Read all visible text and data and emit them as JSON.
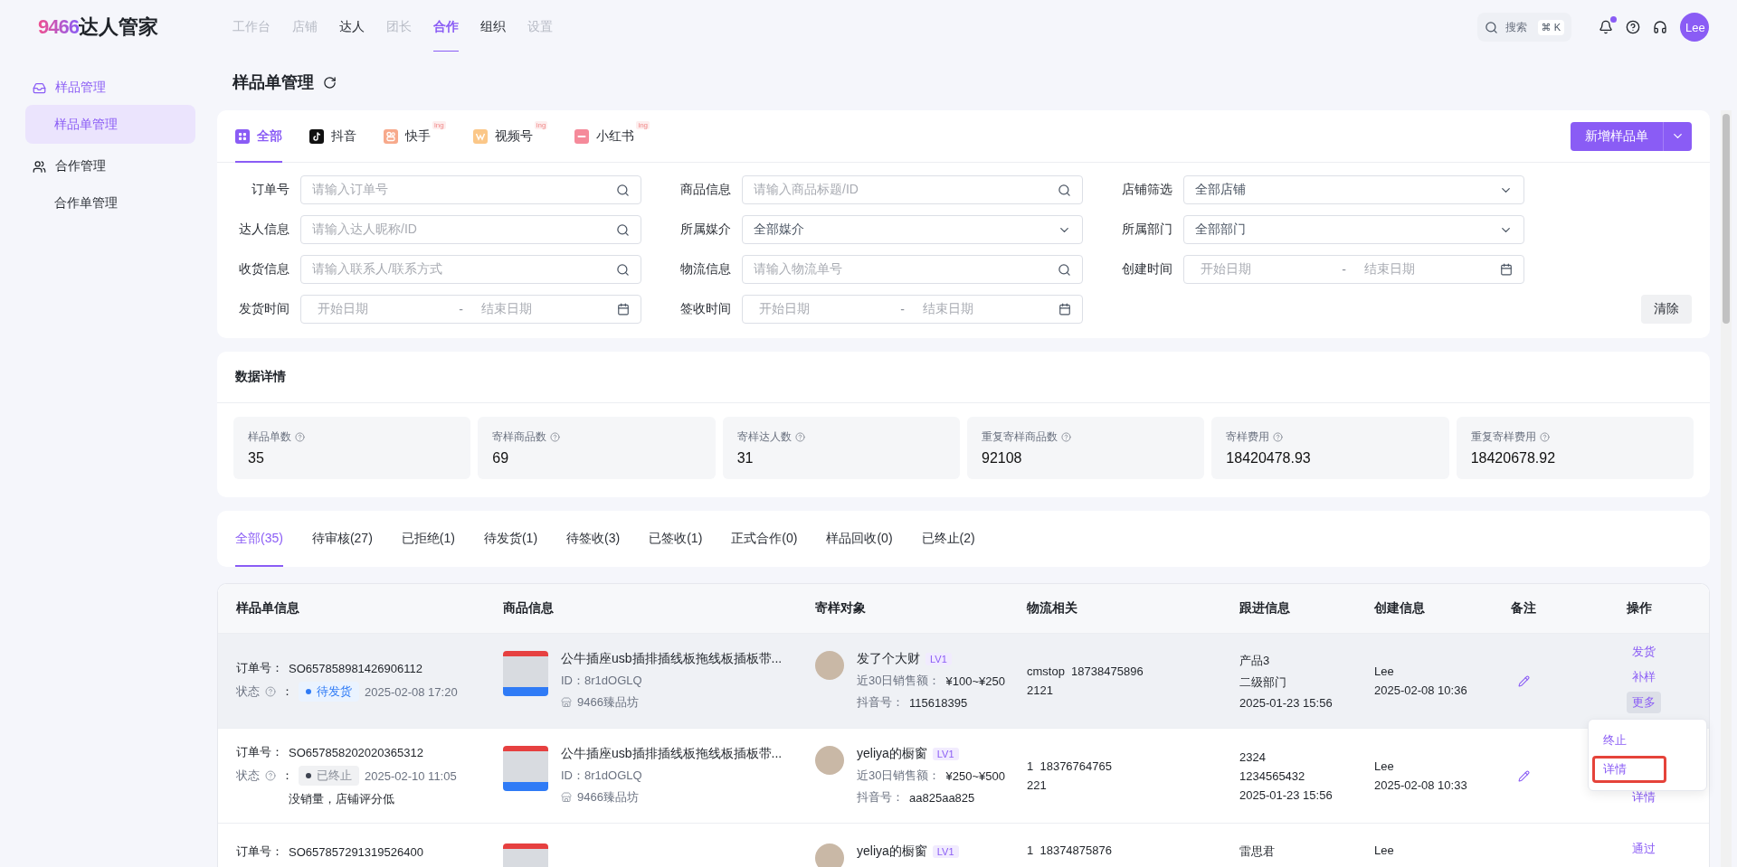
{
  "header": {
    "logo": {
      "number": "9466",
      "text": "达人管家"
    },
    "nav": [
      {
        "label": "工作台",
        "selected": false,
        "disabled": true
      },
      {
        "label": "店铺",
        "selected": false,
        "disabled": true
      },
      {
        "label": "达人",
        "selected": false,
        "disabled": false
      },
      {
        "label": "团长",
        "selected": false,
        "disabled": true
      },
      {
        "label": "合作",
        "selected": true,
        "disabled": false
      },
      {
        "label": "组织",
        "selected": false,
        "disabled": false
      },
      {
        "label": "设置",
        "selected": false,
        "disabled": true
      }
    ],
    "search": {
      "placeholder": "搜索",
      "shortcut": "⌘ K"
    },
    "notification_dot": true,
    "avatar": "Lee"
  },
  "sidebar": [
    {
      "label": "样品管理",
      "kind": "box",
      "active": true,
      "children": [
        {
          "label": "样品单管理",
          "selected": true
        }
      ]
    },
    {
      "label": "合作管理",
      "kind": "people",
      "active": false,
      "children": [
        {
          "label": "合作单管理",
          "selected": false
        }
      ]
    }
  ],
  "page_title": "样品单管理",
  "platform_tabs": [
    {
      "label": "全部",
      "kind": "all",
      "selected": true
    },
    {
      "label": "抖音",
      "kind": "douyin",
      "selected": false
    },
    {
      "label": "快手",
      "kind": "kuaishou",
      "selected": false,
      "badge": "ing"
    },
    {
      "label": "视频号",
      "kind": "shipinhao",
      "selected": false,
      "badge": "ing"
    },
    {
      "label": "小红书",
      "kind": "xiaohongshu",
      "selected": false,
      "badge": "ing"
    }
  ],
  "create_button": "新增样品单",
  "filters": [
    {
      "label": "订单号",
      "kind": "search",
      "placeholder": "请输入订单号"
    },
    {
      "label": "商品信息",
      "kind": "search",
      "placeholder": "请输入商品标题/ID"
    },
    {
      "label": "店铺筛选",
      "kind": "select",
      "value": "全部店铺"
    },
    {
      "label": "达人信息",
      "kind": "search",
      "placeholder": "请输入达人昵称/ID"
    },
    {
      "label": "所属媒介",
      "kind": "select",
      "value": "全部媒介"
    },
    {
      "label": "所属部门",
      "kind": "select",
      "value": "全部部门"
    },
    {
      "label": "收货信息",
      "kind": "search",
      "placeholder": "请输入联系人/联系方式"
    },
    {
      "label": "物流信息",
      "kind": "search",
      "placeholder": "请输入物流单号"
    },
    {
      "label": "创建时间",
      "kind": "daterange",
      "start_placeholder": "开始日期",
      "separator": "-",
      "end_placeholder": "结束日期"
    },
    {
      "label": "发货时间",
      "kind": "daterange",
      "start_placeholder": "开始日期",
      "separator": "-",
      "end_placeholder": "结束日期"
    },
    {
      "label": "签收时间",
      "kind": "daterange",
      "start_placeholder": "开始日期",
      "separator": "-",
      "end_placeholder": "结束日期"
    }
  ],
  "clear_button": "清除",
  "stats": {
    "title": "数据详情",
    "items": [
      {
        "label": "样品单数",
        "value": "35"
      },
      {
        "label": "寄样商品数",
        "value": "69"
      },
      {
        "label": "寄样达人数",
        "value": "31"
      },
      {
        "label": "重复寄样商品数",
        "value": "92108"
      },
      {
        "label": "寄样费用",
        "value": "18420478.93"
      },
      {
        "label": "重复寄样费用",
        "value": "18420678.92"
      }
    ]
  },
  "status_tabs": [
    {
      "label": "全部(35)",
      "selected": true
    },
    {
      "label": "待审核(27)",
      "selected": false
    },
    {
      "label": "已拒绝(1)",
      "selected": false
    },
    {
      "label": "待发货(1)",
      "selected": false
    },
    {
      "label": "待签收(3)",
      "selected": false
    },
    {
      "label": "已签收(1)",
      "selected": false
    },
    {
      "label": "正式合作(0)",
      "selected": false
    },
    {
      "label": "样品回收(0)",
      "selected": false
    },
    {
      "label": "已终止(2)",
      "selected": false
    }
  ],
  "table": {
    "columns": [
      "样品单信息",
      "商品信息",
      "寄样对象",
      "物流相关",
      "跟进信息",
      "创建信息",
      "备注",
      "操作"
    ],
    "rows": [
      {
        "hovered": true,
        "order_label": "订单号：",
        "order_no": "SO657858981426906112",
        "status_label": "状态",
        "status_colon": "：",
        "status": {
          "kind": "pending",
          "label": "待发货"
        },
        "status_time": "2025-02-08 17:20",
        "product": {
          "title": "公牛插座usb插排插线板拖线板插板带...",
          "id_label": "ID：",
          "id": "8r1dOGLQ",
          "shop": "9466臻品坊"
        },
        "target": {
          "name": "发了个大财",
          "level": "LV1",
          "sales_label": "近30日销售额：",
          "sales": "¥100~¥250",
          "account_label": "抖音号：",
          "account": "115618395"
        },
        "logistics": [
          "cmstop  18738475896",
          "2121"
        ],
        "followup": [
          "产品3",
          "二级部门",
          "2025-01-23 15:56"
        ],
        "creator": "Lee",
        "created": "2025-02-08 10:36",
        "actions": [
          {
            "label": "发货",
            "active": false
          },
          {
            "label": "补样",
            "active": false
          },
          {
            "label": "更多",
            "active": true
          }
        ],
        "menu": [
          {
            "label": "终止",
            "highlighted": false
          },
          {
            "label": "详情",
            "highlighted": true
          }
        ]
      },
      {
        "hovered": false,
        "order_label": "订单号：",
        "order_no": "SO657858202020365312",
        "status_label": "状态",
        "status_colon": "：",
        "status": {
          "kind": "terminated",
          "label": "已终止"
        },
        "status_time": "2025-02-10 11:05",
        "note": "没销量，店铺评分低",
        "product": {
          "title": "公牛插座usb插排插线板拖线板插板带...",
          "id_label": "ID：",
          "id": "8r1dOGLQ",
          "shop": "9466臻品坊"
        },
        "target": {
          "name": "yeliya的橱窗",
          "level": "LV1",
          "sales_label": "近30日销售额：",
          "sales": "¥250~¥500",
          "account_label": "抖音号：",
          "account": "aa825aa825"
        },
        "logistics": [
          "1  18376764765",
          "221"
        ],
        "followup": [
          "2324",
          "1234565432",
          "2025-01-23 15:56"
        ],
        "creator": "Lee",
        "created": "2025-02-08 10:33",
        "actions": [
          {
            "label": "详情",
            "active": false
          }
        ]
      },
      {
        "hovered": false,
        "order_label": "订单号：",
        "order_no": "SO657857291319526400",
        "target": {
          "name": "yeliya的橱窗",
          "level": "LV1"
        },
        "logistics": [
          "1  18374875876"
        ],
        "followup": [
          "雷思君"
        ],
        "creator": "Lee",
        "actions": [
          {
            "label": "通过",
            "active": false
          }
        ]
      }
    ]
  }
}
